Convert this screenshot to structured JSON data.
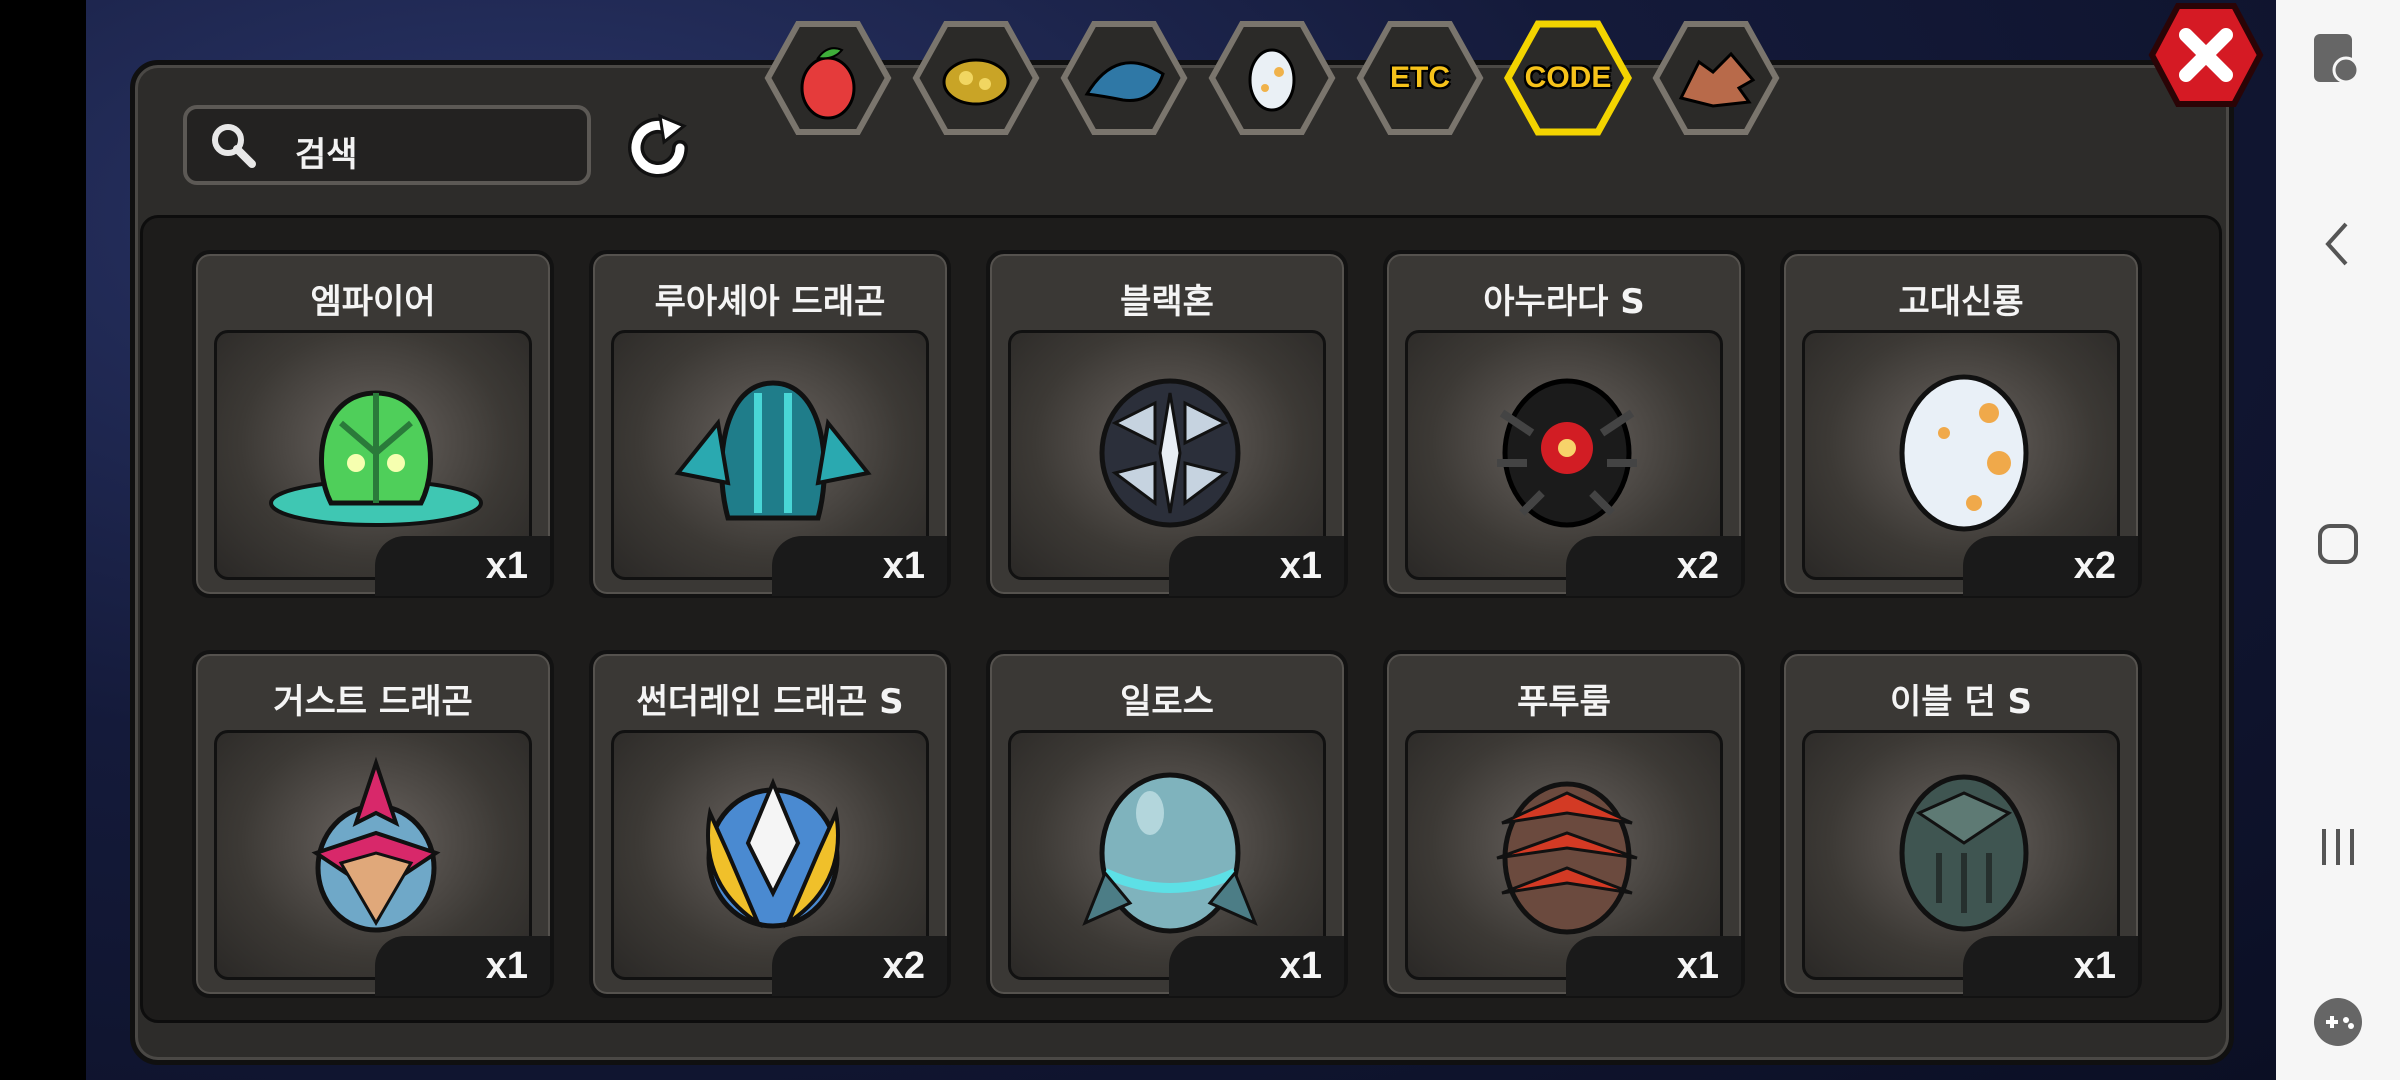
{
  "search": {
    "placeholder": "검색"
  },
  "tabs": [
    {
      "label": "",
      "icon": "fruit-icon"
    },
    {
      "label": "",
      "icon": "gold-ore-icon"
    },
    {
      "label": "",
      "icon": "dragon-scale-icon"
    },
    {
      "label": "",
      "icon": "egg-icon"
    },
    {
      "label": "ETC",
      "icon": ""
    },
    {
      "label": "CODE",
      "icon": "",
      "selected": true
    },
    {
      "label": "",
      "icon": "dragon-head-icon"
    }
  ],
  "items": [
    {
      "name": "엠파이어",
      "count": "x1",
      "egg": "green-crystal-egg"
    },
    {
      "name": "루아셰아 드래곤",
      "count": "x1",
      "egg": "teal-finned-egg"
    },
    {
      "name": "블랙혼",
      "count": "x1",
      "egg": "silver-armored-egg"
    },
    {
      "name": "아누라다 S",
      "count": "x2",
      "egg": "black-red-egg"
    },
    {
      "name": "고대신룡",
      "count": "x2",
      "egg": "white-spotted-egg"
    },
    {
      "name": "거스트 드래곤",
      "count": "x1",
      "egg": "crimson-crest-egg"
    },
    {
      "name": "썬더레인 드래곤 S",
      "count": "x2",
      "egg": "golden-wing-egg"
    },
    {
      "name": "일로스",
      "count": "x1",
      "egg": "aqua-ring-egg"
    },
    {
      "name": "푸투룸",
      "count": "x1",
      "egg": "red-pagoda-egg"
    },
    {
      "name": "이블 던 S",
      "count": "x1",
      "egg": "dark-green-egg"
    }
  ],
  "colors": {
    "selected_tab": "#f3d400",
    "close_button": "#d51a24",
    "count_bg": "#1a1a1a"
  }
}
